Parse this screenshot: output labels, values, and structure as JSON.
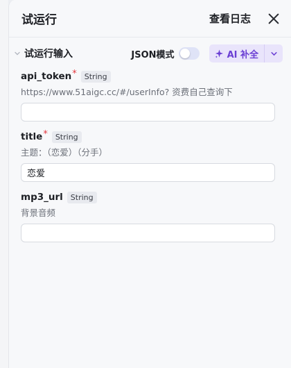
{
  "header": {
    "title": "试运行",
    "log_label": "查看日志",
    "close_icon": "close-icon"
  },
  "input_section": {
    "title": "试运行输入",
    "json_mode_label": "JSON模式",
    "json_mode_on": false,
    "ai_fill_label": "AI 补全",
    "ai_icon": "sparkle-icon",
    "more_icon": "chevron-down-icon"
  },
  "params": [
    {
      "name": "api_token",
      "required": true,
      "required_mark": "*",
      "type": "String",
      "description": "https://www.51aigc.cc/#/userInfo? 资费自己查询下",
      "value": ""
    },
    {
      "name": "title",
      "required": true,
      "required_mark": "*",
      "type": "String",
      "description": "主题：（恋爱）（分手）",
      "value": "恋爱"
    },
    {
      "name": "mp3_url",
      "required": false,
      "type": "String",
      "description": "背景音频",
      "value": ""
    }
  ],
  "colors": {
    "accent": "#6b3fd4",
    "accent_bg": "#e9e4fb",
    "required": "#e5373e",
    "toggle_off": "#dfe3f7"
  }
}
